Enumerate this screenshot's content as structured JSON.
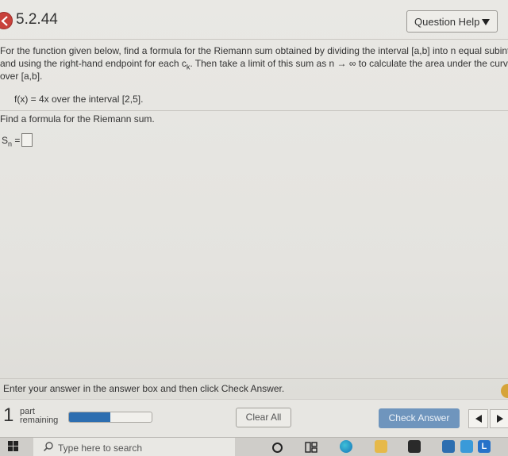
{
  "header": {
    "question_number": "5.2.44",
    "help_button": "Question Help"
  },
  "problem": {
    "line1": "For the function given below, find a formula for the Riemann sum obtained by dividing the interval [a,b] into n equal subinterva",
    "line2": "and using the right-hand endpoint for each c",
    "line2_sub": "k",
    "line2_rest": ". Then take a limit of this sum as n → ∞ to calculate the area under the curve",
    "line3": "over [a,b].",
    "function": "f(x) = 4x over the interval [2,5]."
  },
  "prompt": "Find a formula for the Riemann sum.",
  "answer": {
    "label_main": "S",
    "label_sub": "n",
    "label_eq": " ="
  },
  "footer": {
    "instructions": "Enter your answer in the answer box and then click Check Answer.",
    "parts_count": "1",
    "parts_word": "part",
    "parts_status": "remaining",
    "progress_fraction": 0.5,
    "clear_all": "Clear All",
    "check_answer": "Check Answer"
  },
  "taskbar": {
    "search_placeholder": "Type here to search",
    "l_app": "L"
  },
  "colors": {
    "accent": "#2d6eb0",
    "check_button": "#6f95bd",
    "back_button": "#c8413b"
  }
}
